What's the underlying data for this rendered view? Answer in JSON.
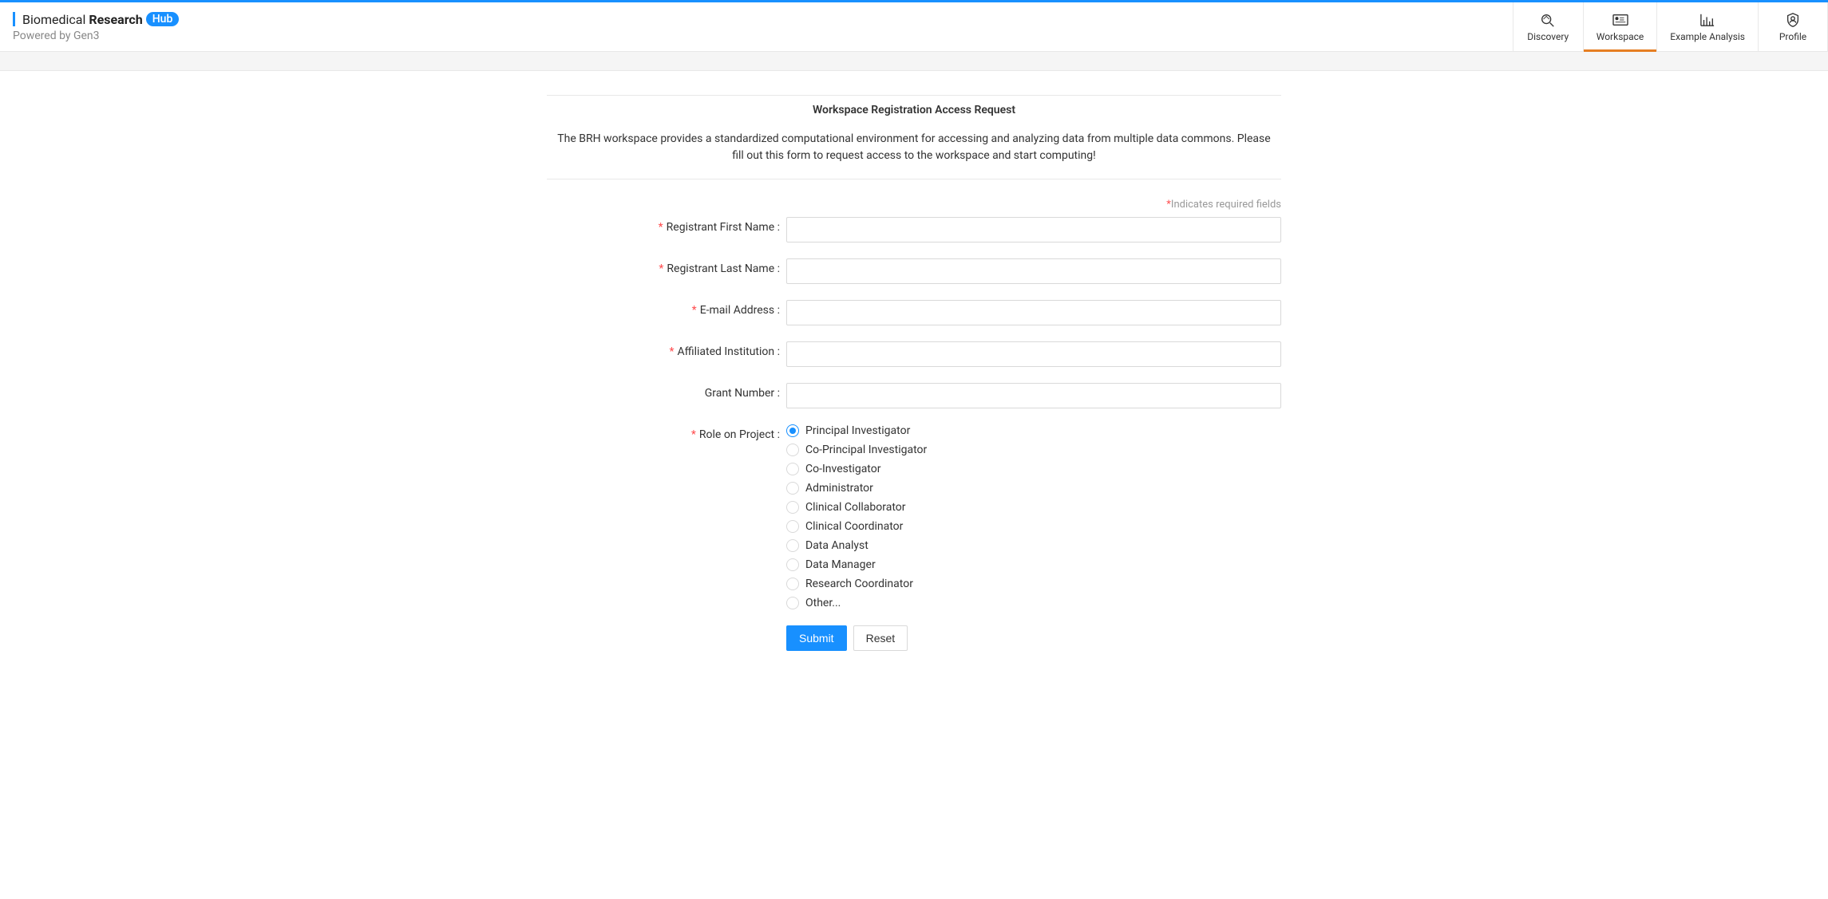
{
  "header": {
    "logo": {
      "text1": "Biomedical",
      "text2": "Research",
      "badge": "Hub",
      "subtitle": "Powered by Gen3"
    },
    "nav": [
      {
        "label": "Discovery",
        "icon": "discovery",
        "active": false
      },
      {
        "label": "Workspace",
        "icon": "workspace",
        "active": true
      },
      {
        "label": "Example Analysis",
        "icon": "analysis",
        "active": false
      },
      {
        "label": "Profile",
        "icon": "profile",
        "active": false
      }
    ]
  },
  "form": {
    "title": "Workspace Registration Access Request",
    "description": "The BRH workspace provides a standardized computational environment for accessing and analyzing data from multiple data commons. Please fill out this form to request access to the workspace and start computing!",
    "required_note": "Indicates required fields",
    "fields": {
      "first_name": {
        "label": "Registrant First Name",
        "required": true,
        "value": ""
      },
      "last_name": {
        "label": "Registrant Last Name",
        "required": true,
        "value": ""
      },
      "email": {
        "label": "E-mail Address",
        "required": true,
        "value": ""
      },
      "institution": {
        "label": "Affiliated Institution",
        "required": true,
        "value": ""
      },
      "grant": {
        "label": "Grant Number",
        "required": false,
        "value": ""
      },
      "role": {
        "label": "Role on Project",
        "required": true,
        "selected": "Principal Investigator"
      }
    },
    "role_options": [
      "Principal Investigator",
      "Co-Principal Investigator",
      "Co-Investigator",
      "Administrator",
      "Clinical Collaborator",
      "Clinical Coordinator",
      "Data Analyst",
      "Data Manager",
      "Research Coordinator",
      "Other..."
    ],
    "buttons": {
      "submit": "Submit",
      "reset": "Reset"
    }
  }
}
